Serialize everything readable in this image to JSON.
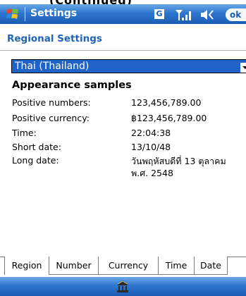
{
  "title_bar": {
    "app_title": "Settings",
    "g_icon_label": "G",
    "ok_label": "ok"
  },
  "top_clipped_text": "(Continued)",
  "page": {
    "heading": "Regional Settings",
    "locale_select": {
      "value": "Thai (Thailand)"
    },
    "section_title": "Appearance samples",
    "samples": [
      {
        "label": "Positive numbers:",
        "value": "123,456,789.00"
      },
      {
        "label": "Positive currency:",
        "value": "฿123,456,789.00"
      },
      {
        "label": "Time:",
        "value": "22:04:38"
      },
      {
        "label": "Short date:",
        "value": "13/10/48"
      },
      {
        "label": "Long date:",
        "value": "วันพฤหัสบดีที่ 13 ตุลาคม",
        "value2": "พ.ศ. 2548"
      }
    ]
  },
  "tabs": [
    {
      "label": "Region",
      "active": true
    },
    {
      "label": "Number",
      "active": false
    },
    {
      "label": "Currency",
      "active": false
    },
    {
      "label": "Time",
      "active": false
    },
    {
      "label": "Date",
      "active": false
    }
  ],
  "colors": {
    "accent": "#1f63b6",
    "title_bar": "#2e76cf",
    "selection": "#1f63c8"
  }
}
